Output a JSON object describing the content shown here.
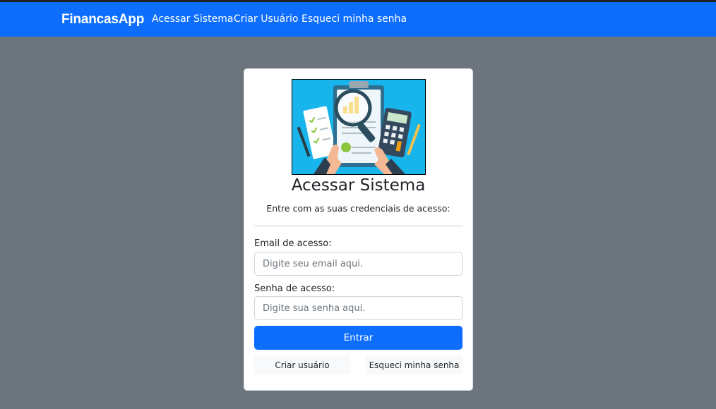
{
  "navbar": {
    "brand": "FinancasApp",
    "links": [
      "Acessar Sistema",
      "Criar Usuário",
      "Esqueci minha senha"
    ]
  },
  "card": {
    "illustration": "financial-audit-illustration",
    "title": "Acessar Sistema",
    "subtitle": "Entre com as suas credenciais de acesso:",
    "email": {
      "label": "Email de acesso:",
      "placeholder": "Digite seu email aqui."
    },
    "password": {
      "label": "Senha de acesso:",
      "placeholder": "Digite sua senha aqui."
    },
    "submit_label": "Entrar",
    "create_user_label": "Criar usuário",
    "forgot_password_label": "Esqueci minha senha"
  },
  "colors": {
    "primary": "#0d6efd",
    "background": "#6c757d",
    "illustration_bg": "#17b5ec"
  }
}
